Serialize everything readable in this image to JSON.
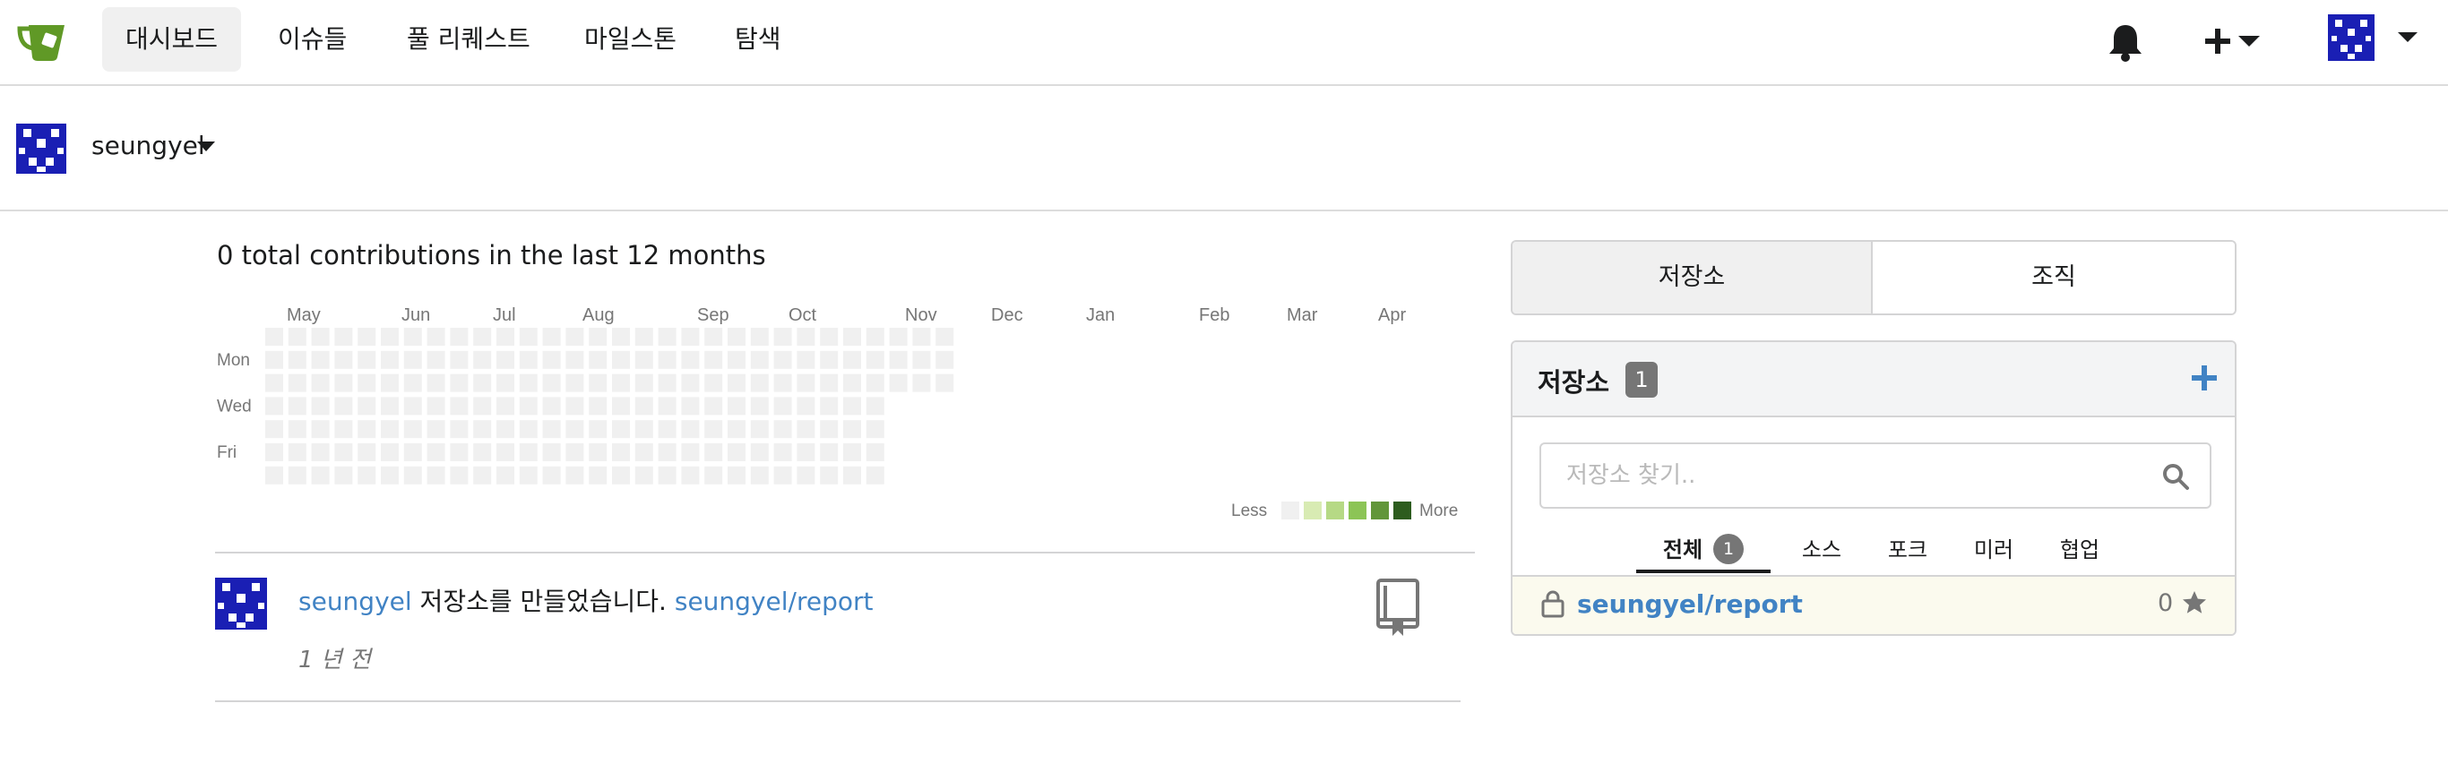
{
  "nav": {
    "items": [
      {
        "label": "대시보드",
        "active": true
      },
      {
        "label": "이슈들"
      },
      {
        "label": "풀 리퀘스트"
      },
      {
        "label": "마일스톤"
      },
      {
        "label": "탐색"
      }
    ],
    "icons": [
      "gitea-logo-icon",
      "bell-icon",
      "plus-icon",
      "avatar"
    ]
  },
  "context_user": {
    "name": "seungyel"
  },
  "contributions": {
    "title": "0 total contributions in the last 12 months",
    "months": [
      "May",
      "Jun",
      "Jul",
      "Aug",
      "Sep",
      "Oct",
      "Nov",
      "Dec",
      "Jan",
      "Feb",
      "Mar",
      "Apr"
    ],
    "days": [
      "Mon",
      "Wed",
      "Fri"
    ],
    "legend_less": "Less",
    "legend_more": "More",
    "total": 0,
    "legend_colors": [
      "#f0f0f0",
      "#d8ebb3",
      "#b6d985",
      "#8cc456",
      "#62963a",
      "#2d5c1e"
    ]
  },
  "feed": [
    {
      "user": "seungyel",
      "action": " 저장소를 만들었습니다. ",
      "repo": "seungyel/report",
      "time": "1 년 전"
    }
  ],
  "panel": {
    "tabs": [
      "저장소",
      "조직"
    ],
    "repos_title": "저장소",
    "repos_count": "1",
    "search_placeholder": "저장소 찾기..",
    "filters": [
      {
        "label": "전체",
        "count": "1",
        "active": true
      },
      {
        "label": "소스"
      },
      {
        "label": "포크"
      },
      {
        "label": "미러"
      },
      {
        "label": "협업"
      }
    ],
    "repo_list": [
      {
        "name": "seungyel/report",
        "stars": "0",
        "private": true
      }
    ]
  },
  "colors": {
    "link": "#4183c4",
    "badge": "#767676",
    "avatar_blue": "#1a1fb4",
    "logo_green": "#609926"
  }
}
